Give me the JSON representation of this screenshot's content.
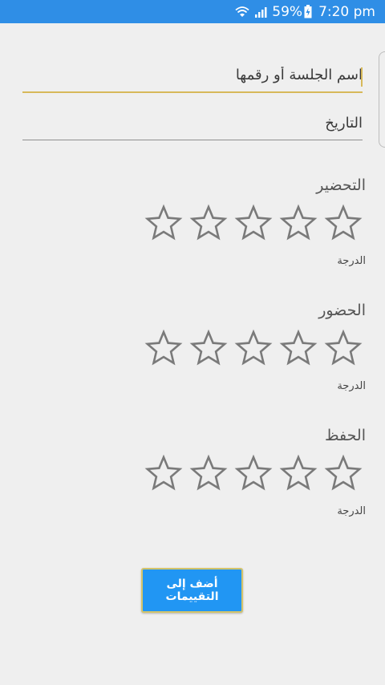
{
  "status_bar": {
    "battery_percent": "59%",
    "time": "7:20 pm"
  },
  "form": {
    "session_placeholder": "اسم الجلسة أو رقمها",
    "date_placeholder": "التاريخ"
  },
  "ratings": [
    {
      "title": "التحضير",
      "grade_label": "الدرجة",
      "stars_total": 5,
      "stars_filled": 0
    },
    {
      "title": "الحضور",
      "grade_label": "الدرجة",
      "stars_total": 5,
      "stars_filled": 0
    },
    {
      "title": "الحفظ",
      "grade_label": "الدرجة",
      "stars_total": 5,
      "stars_filled": 0
    }
  ],
  "actions": {
    "add_label": "أضف إلى التقييمات"
  },
  "colors": {
    "status_bar": "#2f8ee6",
    "background": "#efefef",
    "accent_underline": "#d7b95a",
    "button": "#2196f3",
    "star_outline": "#7a7a7a"
  },
  "icons": {
    "wifi": "wifi-icon",
    "signal": "signal-icon",
    "battery": "battery-charging-icon",
    "star": "star-outline-icon"
  }
}
